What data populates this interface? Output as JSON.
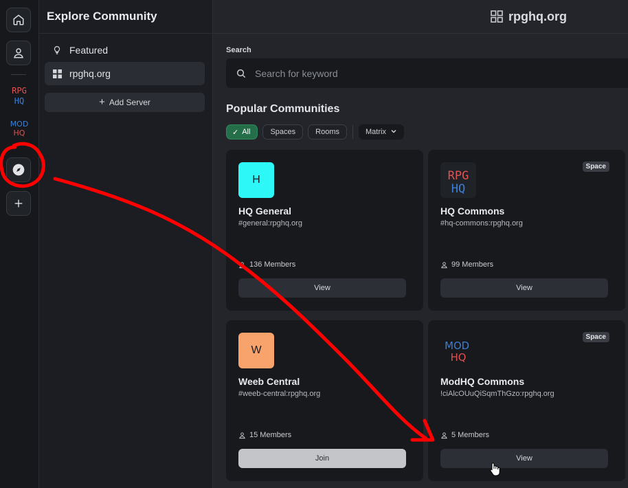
{
  "rail": {
    "items": [
      "home-icon",
      "user-icon",
      "rpghq-logo",
      "modhq-logo",
      "compass-icon",
      "plus-icon"
    ],
    "logos": {
      "rpg_top": "RPG",
      "rpg_bottom": "HQ",
      "mod_top": "MOD",
      "mod_bottom": "HQ"
    }
  },
  "sidebar": {
    "title": "Explore Community",
    "items": [
      {
        "label": "Featured",
        "icon": "lightbulb-icon"
      },
      {
        "label": "rpghq.org",
        "icon": "grid-icon",
        "active": true
      }
    ],
    "add_server": "Add Server"
  },
  "main": {
    "server_title": "rpghq.org",
    "search": {
      "label": "Search",
      "placeholder": "Search for keyword"
    },
    "section_title": "Popular Communities",
    "filters": {
      "all": "All",
      "spaces": "Spaces",
      "rooms": "Rooms",
      "matrix": "Matrix"
    },
    "cards": [
      {
        "letter": "H",
        "avatar_color": "#2ef7f7",
        "name": "HQ General",
        "alias": "#general:rpghq.org",
        "members": "136 Members",
        "button": "View",
        "badge": ""
      },
      {
        "letter": "",
        "avatar": "RPG HQ logo",
        "name": "HQ Commons",
        "alias": "#hq-commons:rpghq.org",
        "members": "99 Members",
        "button": "View",
        "badge": "Space"
      },
      {
        "letter": "W",
        "avatar_color": "#f7a36b",
        "name": "Weeb Central",
        "alias": "#weeb-central:rpghq.org",
        "members": "15 Members",
        "button": "Join",
        "badge": ""
      },
      {
        "letter": "",
        "avatar": "MOD HQ logo",
        "name": "ModHQ Commons",
        "alias": "!ciAlcOUuQiSqmThGzo:rpghq.org",
        "members": "5 Members",
        "button": "View",
        "badge": "Space"
      }
    ]
  },
  "colors": {
    "accent_green": "#256e4a",
    "annotation_red": "#ff0000",
    "rpg_red": "#e05252",
    "hq_blue": "#3b7fd6"
  }
}
